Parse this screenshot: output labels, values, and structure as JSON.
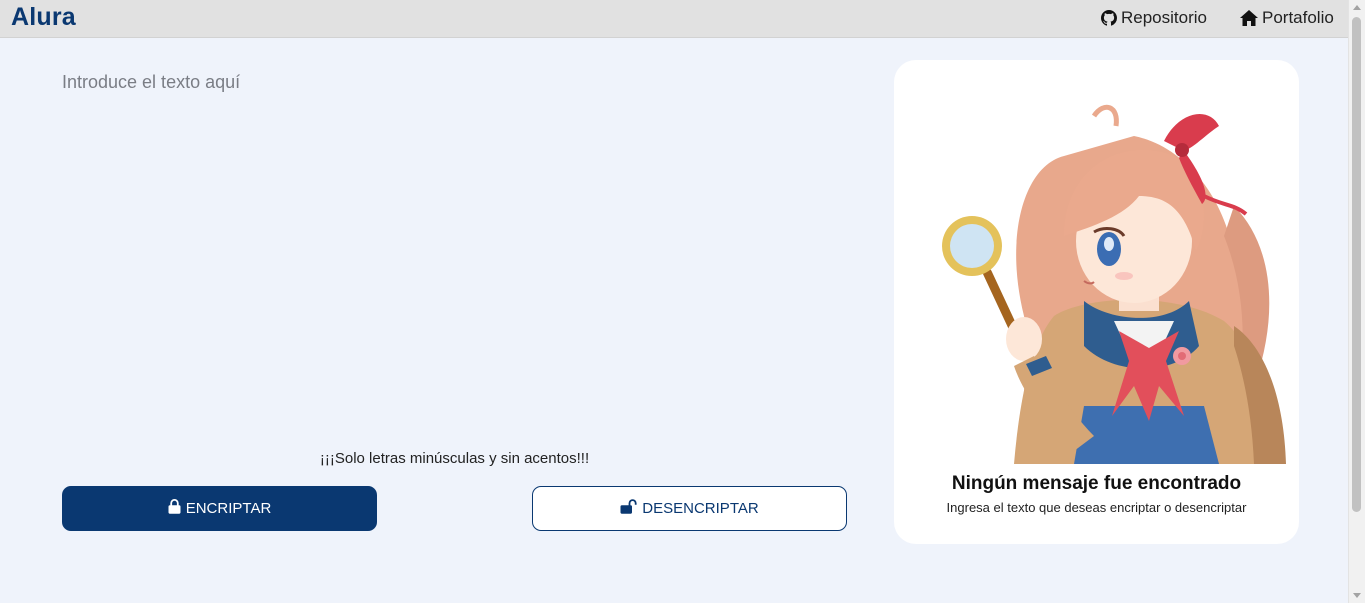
{
  "header": {
    "logo": "Alura",
    "nav": [
      {
        "label": "Repositorio",
        "icon": "github-icon"
      },
      {
        "label": "Portafolio",
        "icon": "home-icon"
      }
    ]
  },
  "input": {
    "placeholder": "Introduce el texto aquí",
    "value": ""
  },
  "warning": "¡¡¡Solo letras minúsculas y sin acentos!!!",
  "buttons": {
    "encrypt": {
      "label": "ENCRIPTAR",
      "icon": "lock-icon"
    },
    "decrypt": {
      "label": "DESENCRIPTAR",
      "icon": "unlock-icon"
    }
  },
  "result_panel": {
    "illustration": "anime-girl-magnifying-glass",
    "title": "Ningún mensaje fue encontrado",
    "subtitle": "Ingresa el texto que deseas encriptar o desencriptar"
  },
  "colors": {
    "primary": "#0a3871",
    "background": "#eff3fb",
    "header": "#e1e1e1",
    "card": "#ffffff"
  }
}
